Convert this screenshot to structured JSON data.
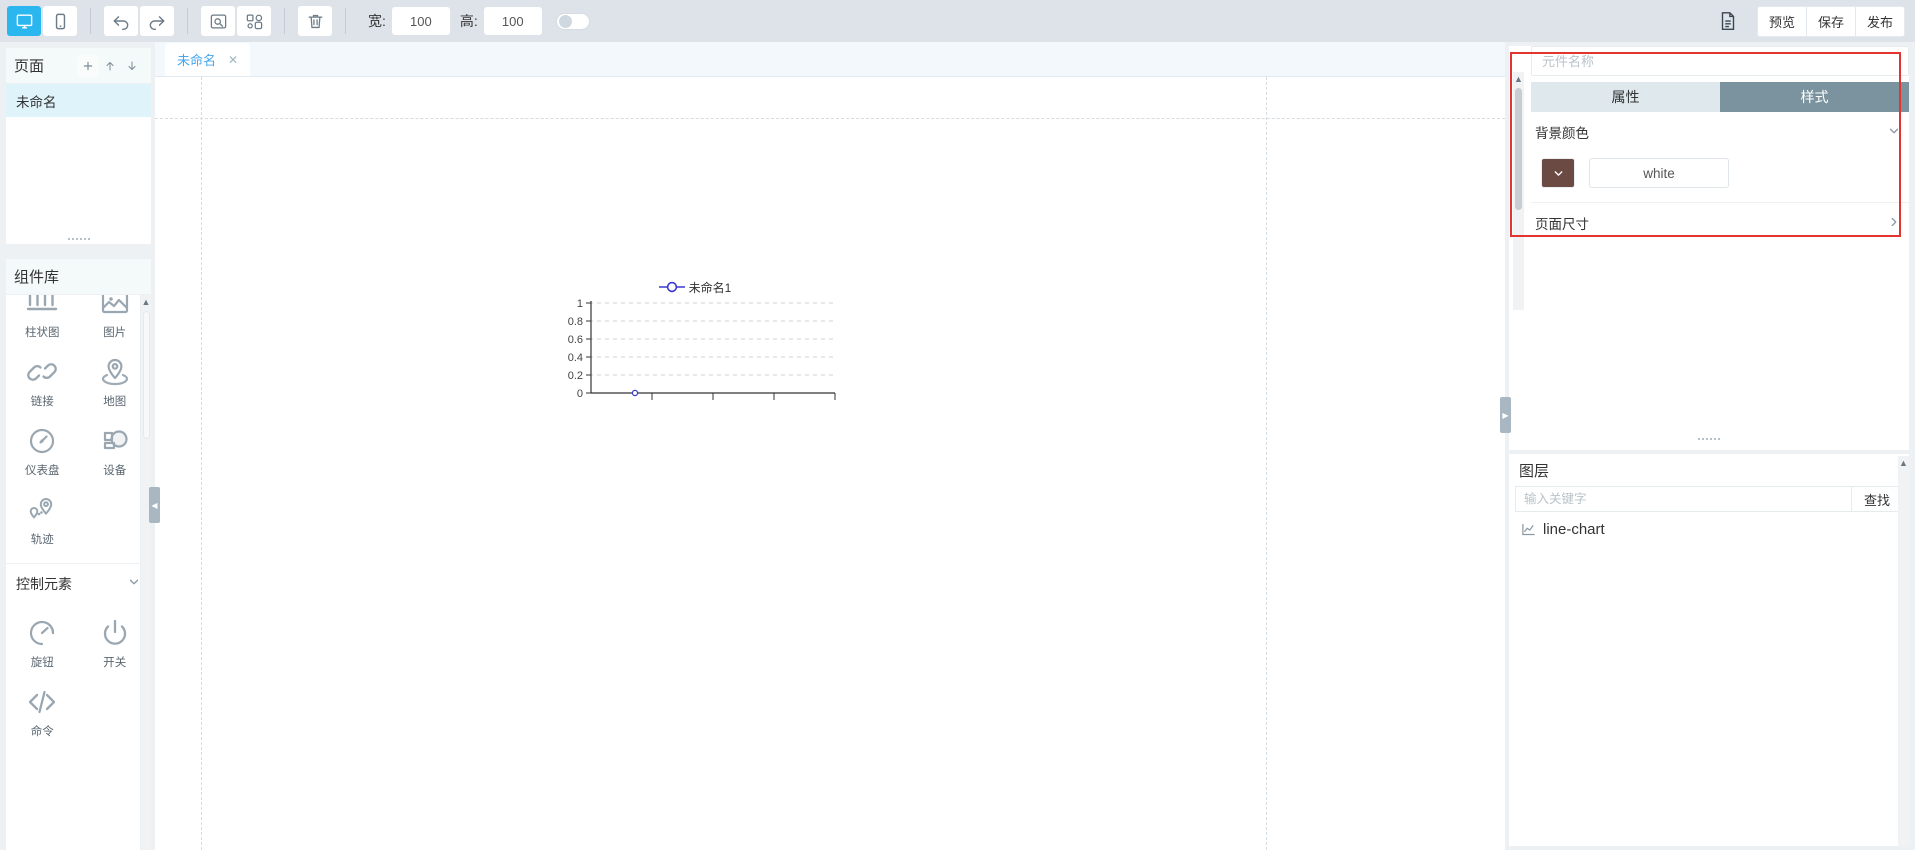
{
  "toolbar": {
    "devices": [
      {
        "name": "desktop-view",
        "icon": "monitor-icon",
        "active": true
      },
      {
        "name": "mobile-view",
        "icon": "phone-icon",
        "active": false
      }
    ],
    "history": [
      {
        "name": "undo-button",
        "icon": "undo-arrow-icon"
      },
      {
        "name": "redo-button",
        "icon": "redo-arrow-icon"
      }
    ],
    "grouping": [
      {
        "name": "group-button",
        "icon": "group-icon"
      },
      {
        "name": "ungroup-button",
        "icon": "ungroup-icon"
      }
    ],
    "delete": {
      "name": "delete-button",
      "icon": "trash-icon"
    },
    "width_label": "宽:",
    "width_value": "100",
    "height_label": "高:",
    "height_value": "100",
    "lock_toggle": "off",
    "doc_icon": "document-icon",
    "actions": [
      "预览",
      "保存",
      "发布"
    ]
  },
  "pages": {
    "title": "页面",
    "add_icon": "plus-icon",
    "up_icon": "arrow-up-icon",
    "down_icon": "arrow-down-icon",
    "items": [
      {
        "label": "未命名",
        "selected": true
      }
    ]
  },
  "library": {
    "title": "组件库",
    "chart_group": {
      "items": [
        {
          "label": "柱状图",
          "icon": "bar-chart-icon"
        },
        {
          "label": "图片",
          "icon": "image-icon"
        },
        {
          "label": "链接",
          "icon": "link-icon"
        },
        {
          "label": "地图",
          "icon": "map-pin-icon"
        },
        {
          "label": "仪表盘",
          "icon": "gauge-icon"
        },
        {
          "label": "设备",
          "icon": "device-icon"
        },
        {
          "label": "轨迹",
          "icon": "track-icon"
        }
      ]
    },
    "control_group": {
      "title": "控制元素",
      "collapse_icon": "chevron-down-icon",
      "items": [
        {
          "label": "旋钮",
          "icon": "knob-icon"
        },
        {
          "label": "开关",
          "icon": "power-icon"
        },
        {
          "label": "命令",
          "icon": "code-icon"
        }
      ]
    }
  },
  "canvas": {
    "tabs": [
      {
        "label": "未命名",
        "close_icon": "close-icon",
        "active": true
      }
    ]
  },
  "chart_data": {
    "type": "line",
    "title": "",
    "legend": [
      "未命名1"
    ],
    "legend_position": "top-center",
    "series": [
      {
        "name": "未命名1",
        "values": [
          0
        ],
        "color": "#3a3ad0"
      }
    ],
    "x": [
      0
    ],
    "xlabel": "",
    "ylabel": "",
    "ylim": [
      0,
      1
    ],
    "yticks": [
      "0",
      "0.2",
      "0.4",
      "0.6",
      "0.8",
      "1"
    ],
    "xticks": [
      "",
      "",
      "",
      ""
    ],
    "grid": true
  },
  "properties": {
    "name_placeholder": "元件名称",
    "name_value": "",
    "tabs": [
      {
        "label": "属性",
        "active": false
      },
      {
        "label": "样式",
        "active": true
      }
    ],
    "bg_color": {
      "label": "背景颜色",
      "collapse_icon": "chevron-down-icon",
      "swatch_hex": "#6b4a44",
      "swatch_icon": "chevron-down-icon",
      "value": "white"
    },
    "page_size": {
      "label": "页面尺寸",
      "expand_icon": "chevron-right-icon"
    },
    "highlight_color": "#e3342f"
  },
  "layers": {
    "title": "图层",
    "search_placeholder": "输入关键字",
    "search_value": "",
    "find_label": "查找",
    "items": [
      {
        "label": "line-chart",
        "icon": "line-chart-icon"
      }
    ]
  }
}
